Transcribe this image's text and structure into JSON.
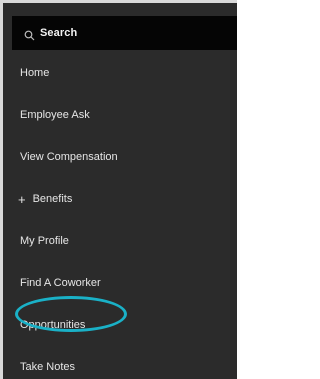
{
  "search": {
    "label": "Search",
    "icon": "search-icon"
  },
  "menu": {
    "items": [
      {
        "label": "Home"
      },
      {
        "label": "Employee Ask"
      },
      {
        "label": "View Compensation"
      },
      {
        "label": "Benefits",
        "prefix": "+",
        "expandable": true
      },
      {
        "label": "My Profile"
      },
      {
        "label": "Find A Coworker"
      },
      {
        "label": "Opportunities",
        "highlighted": true
      },
      {
        "label": "Take Notes"
      }
    ]
  },
  "colors": {
    "sidebar_bg": "#2b2b2b",
    "search_bg": "#050505",
    "text": "#e6e6e6",
    "highlight_ring": "#1ab1c7"
  }
}
